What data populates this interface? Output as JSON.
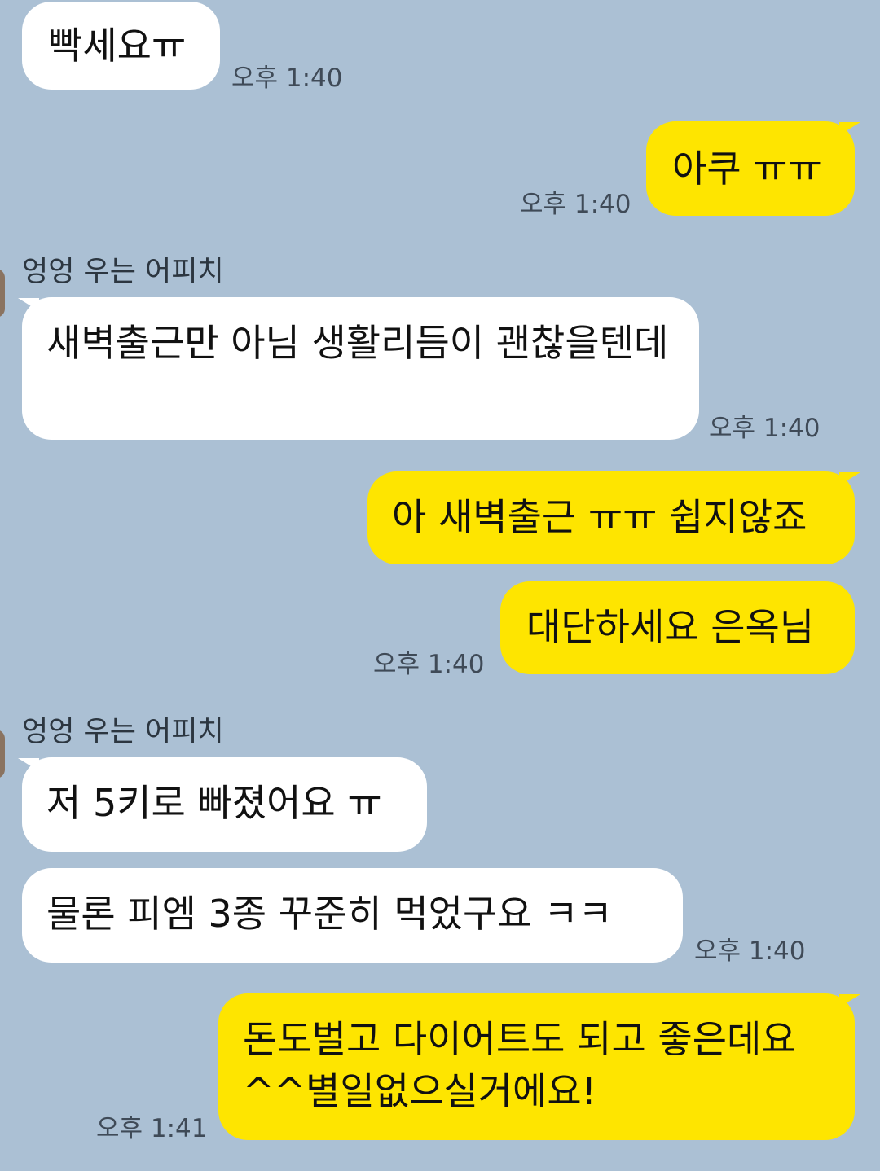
{
  "chat": {
    "sender_name": "엉엉 우는 어피치",
    "messages": [
      {
        "side": "in",
        "text": "빡세요ㅠ",
        "time": "오후 1:40"
      },
      {
        "side": "out",
        "text": "아쿠 ㅠㅠ",
        "time": "오후 1:40"
      },
      {
        "side": "in",
        "sender": "엉엉 우는 어피치",
        "text": "새벽출근만 아님 생활리듬이 괜찮을텐데",
        "time": "오후 1:40"
      },
      {
        "side": "out",
        "text": "아 새벽출근 ㅠㅠ 쉽지않죠"
      },
      {
        "side": "out",
        "text": "대단하세요 은옥님",
        "time": "오후 1:40"
      },
      {
        "side": "in",
        "sender": "엉엉 우는 어피치",
        "text": "저 5키로 빠졌어요 ㅠ"
      },
      {
        "side": "in",
        "text": "물론  피엠 3종 꾸준히 먹었구요 ㅋㅋ",
        "time": "오후 1:40"
      },
      {
        "side": "out",
        "text": "돈도벌고 다이어트도 되고 좋은데요 ^^별일없으실거에요!",
        "time": "오후 1:41"
      }
    ]
  },
  "colors": {
    "background": "#abc0d4",
    "incoming_bubble": "#ffffff",
    "outgoing_bubble": "#fee500",
    "time_text": "#3f4a57"
  }
}
